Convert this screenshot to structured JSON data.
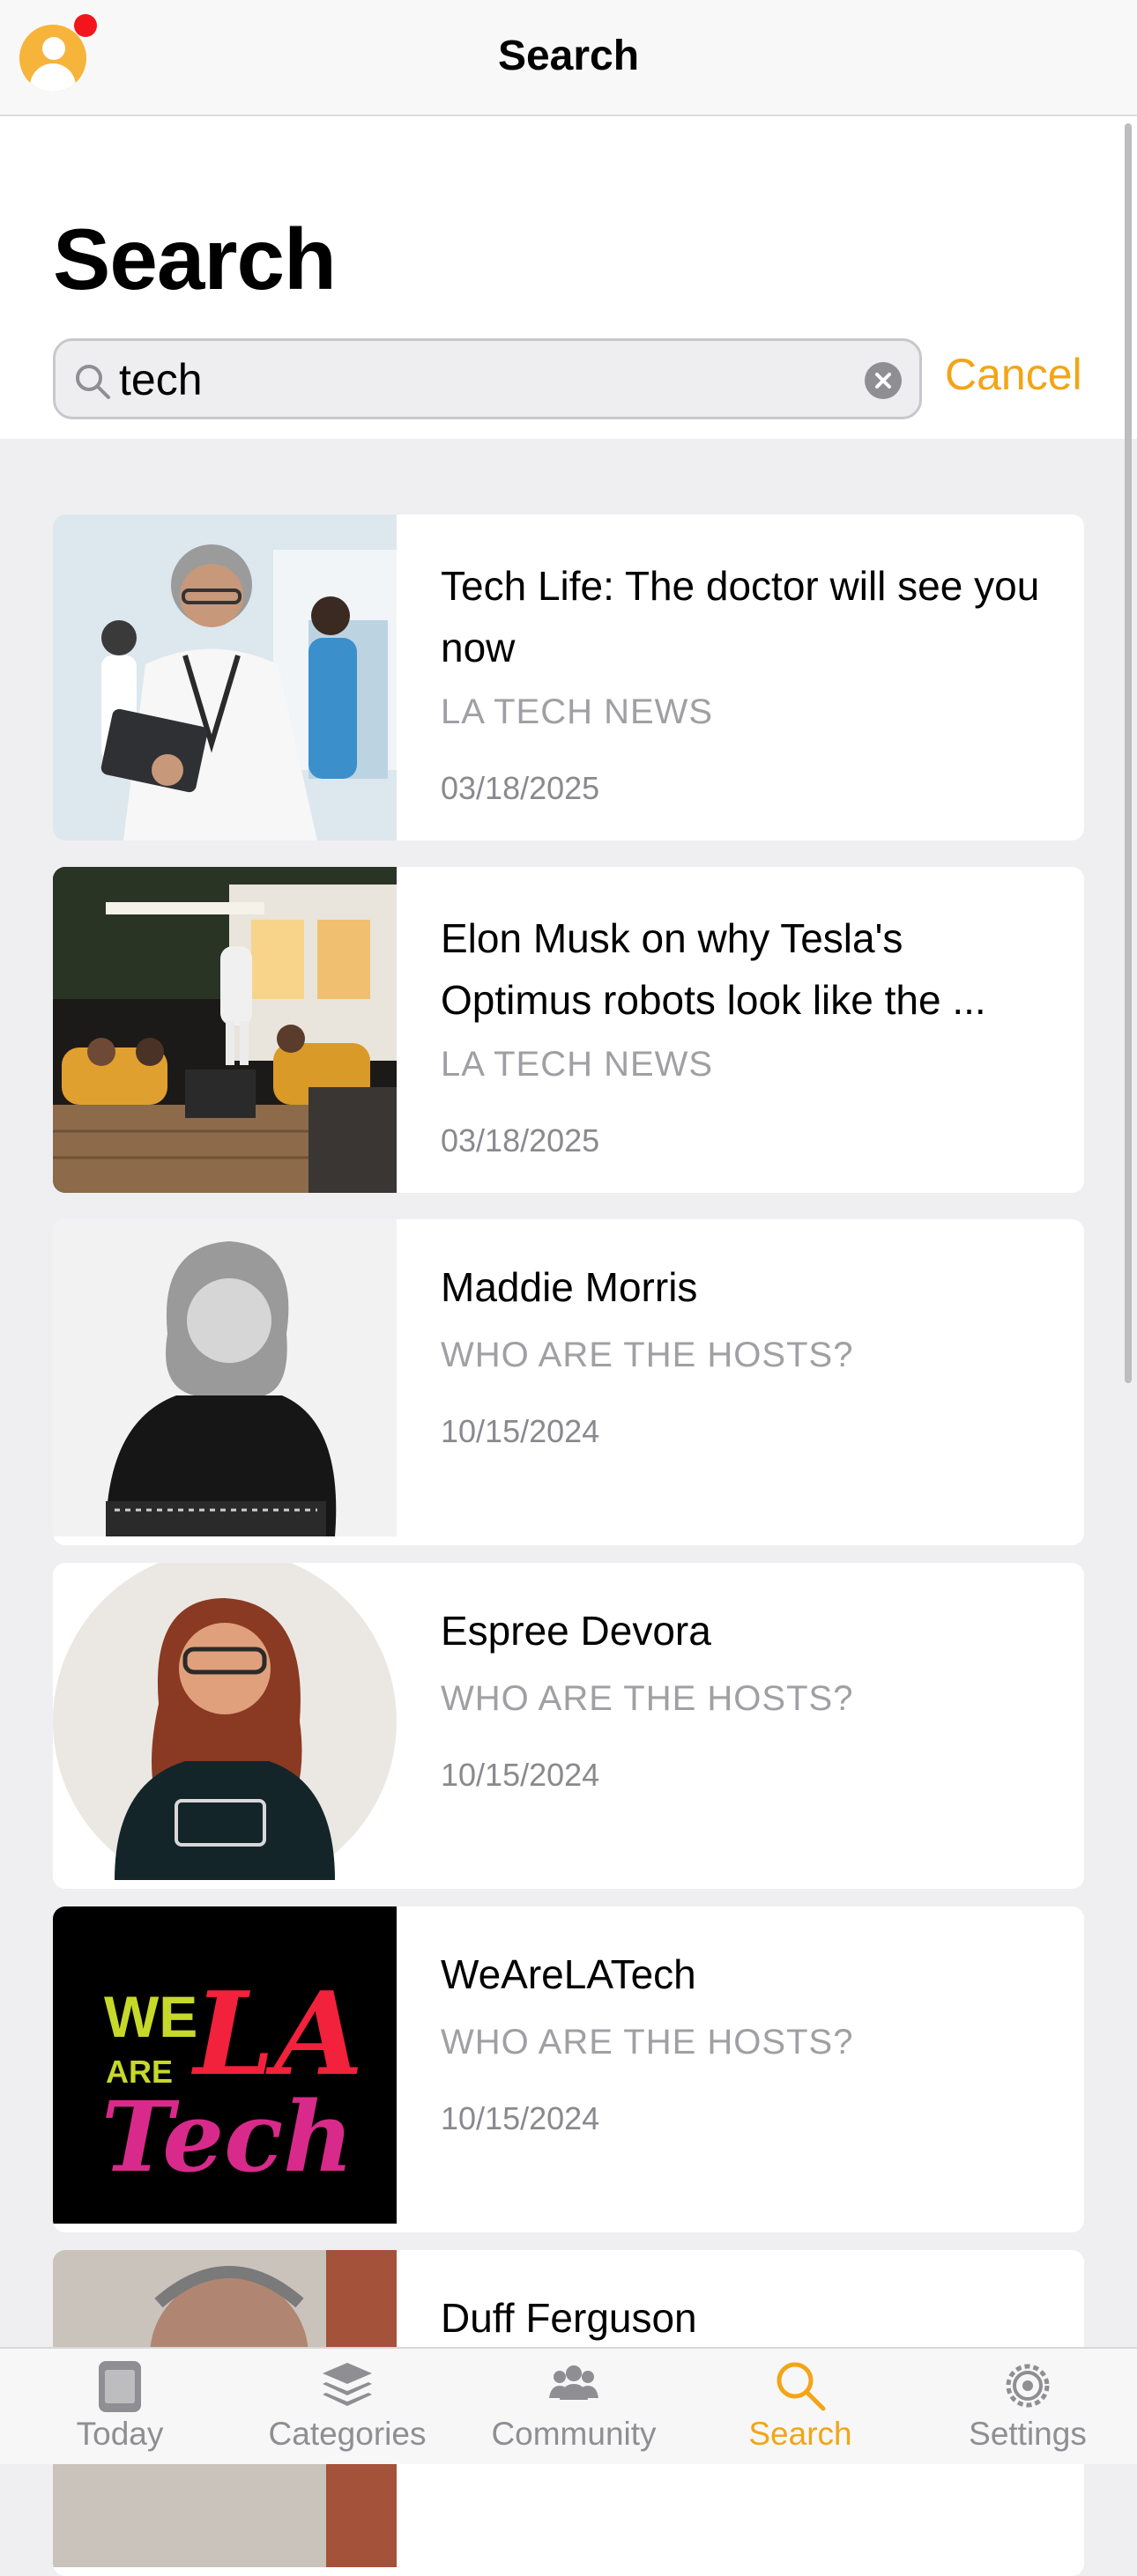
{
  "navbar": {
    "title": "Search"
  },
  "header": {
    "title": "Search",
    "search": {
      "value": "tech",
      "placeholder": ""
    },
    "cancel_label": "Cancel"
  },
  "results": [
    {
      "title": "Tech Life: The doctor will see you now",
      "source": "LA TECH NEWS",
      "date": "03/18/2025"
    },
    {
      "title": "Elon Musk on why Tesla's Optimus robots look like the ...",
      "source": "LA TECH NEWS",
      "date": "03/18/2025"
    },
    {
      "title": "Maddie Morris",
      "source": "WHO ARE THE HOSTS?",
      "date": "10/15/2024"
    },
    {
      "title": "Espree Devora",
      "source": "WHO ARE THE HOSTS?",
      "date": "10/15/2024"
    },
    {
      "title": "WeAreLATech",
      "source": "WHO ARE THE HOSTS?",
      "date": "10/15/2024"
    },
    {
      "title": "Duff Ferguson",
      "source": "",
      "date": ""
    }
  ],
  "logo": {
    "we": "WE",
    "are": "ARE",
    "la": "LA",
    "tech": "Tech"
  },
  "tabs": [
    {
      "label": "Today",
      "icon": "today-icon"
    },
    {
      "label": "Categories",
      "icon": "stack-icon"
    },
    {
      "label": "Community",
      "icon": "people-icon"
    },
    {
      "label": "Search",
      "icon": "search-icon",
      "active": true
    },
    {
      "label": "Settings",
      "icon": "gear-icon"
    }
  ],
  "colors": {
    "accent": "#f2a516",
    "notification": "#f4141c",
    "muted": "#8e8e93"
  }
}
